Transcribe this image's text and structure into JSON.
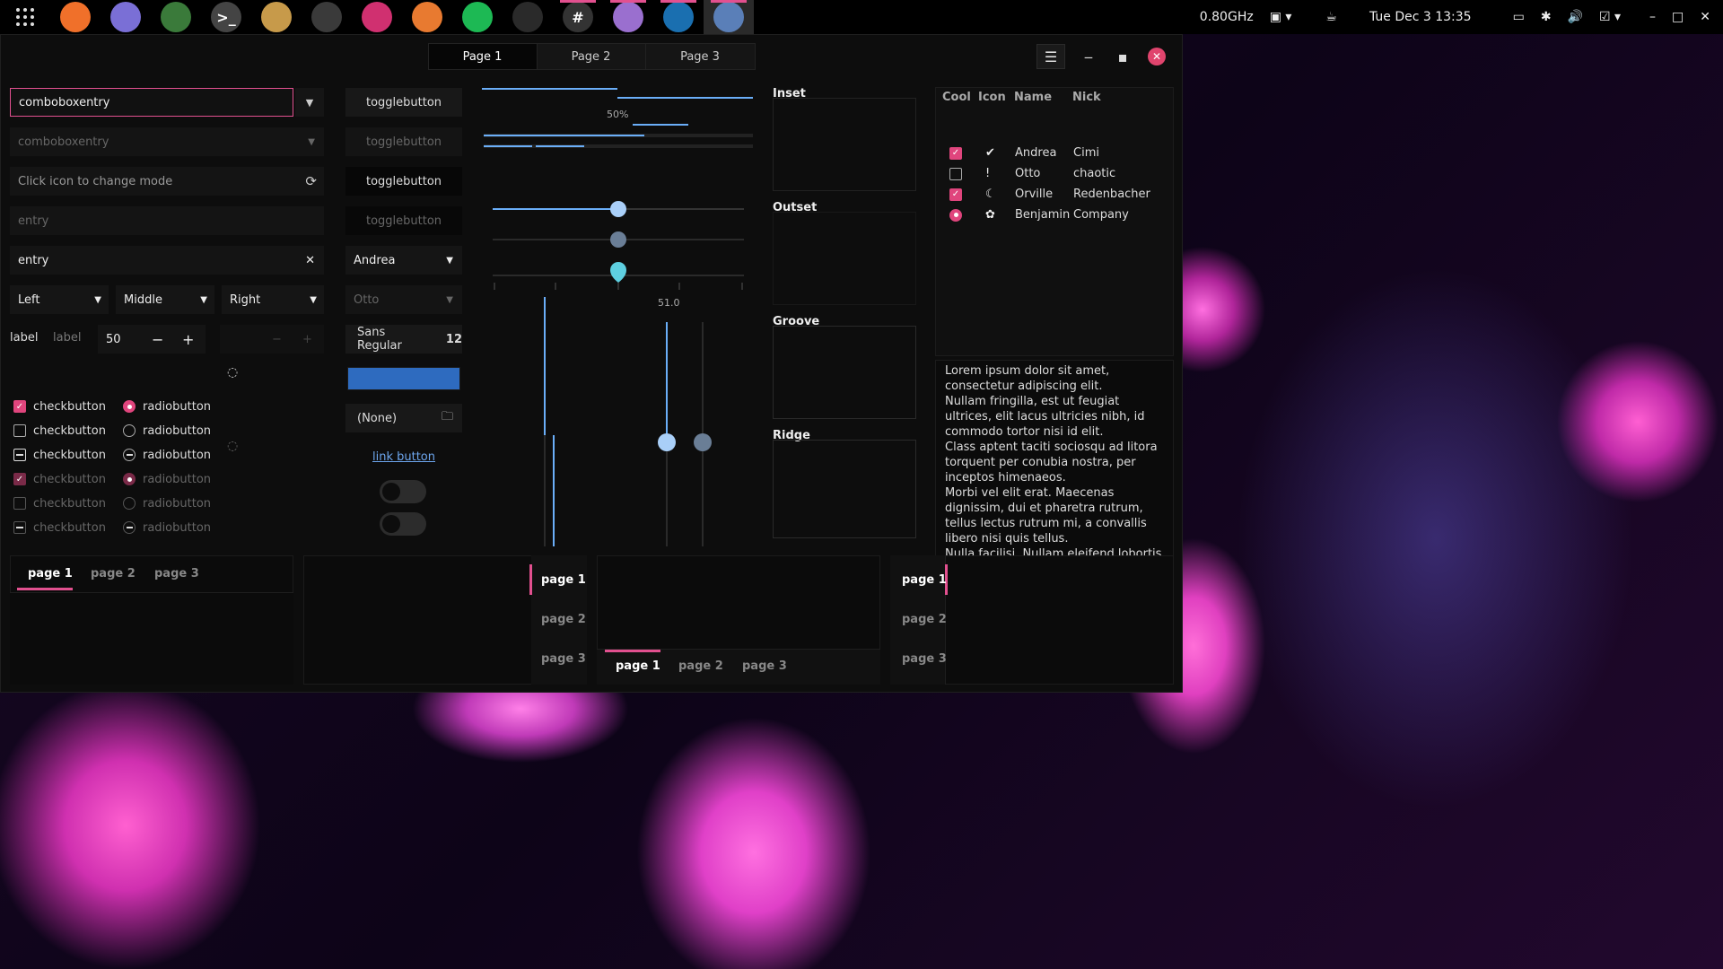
{
  "topbar": {
    "apps": [
      {
        "icon": "firefox-icon",
        "color": "#f0702a",
        "glyph": "",
        "active": false,
        "indicator": false
      },
      {
        "icon": "files-icon",
        "color": "#7a6fd6",
        "glyph": "",
        "active": false,
        "indicator": false
      },
      {
        "icon": "android-studio-icon",
        "color": "#3a7a3a",
        "glyph": "",
        "active": false,
        "indicator": false
      },
      {
        "icon": "terminal-icon",
        "color": "#444",
        "glyph": ">_",
        "active": false,
        "indicator": false
      },
      {
        "icon": "archive-manager-icon",
        "color": "#c79a4a",
        "glyph": "",
        "active": false,
        "indicator": false
      },
      {
        "icon": "darktable-icon",
        "color": "#3a3a3a",
        "glyph": "",
        "active": false,
        "indicator": false
      },
      {
        "icon": "color-picker-icon",
        "color": "#d03070",
        "glyph": "",
        "active": false,
        "indicator": false
      },
      {
        "icon": "hexchat-icon",
        "color": "#e87a30",
        "glyph": "",
        "active": false,
        "indicator": false
      },
      {
        "icon": "spotify-icon",
        "color": "#1db954",
        "glyph": "",
        "active": false,
        "indicator": false
      },
      {
        "icon": "steam-icon",
        "color": "#2a2a2a",
        "glyph": "",
        "active": false,
        "indicator": false
      },
      {
        "icon": "slack-icon",
        "color": "#333",
        "glyph": "#",
        "active": false,
        "indicator": true
      },
      {
        "icon": "text-editor-icon",
        "color": "#9a6fcf",
        "glyph": "",
        "active": false,
        "indicator": true
      },
      {
        "icon": "virtualbox-icon",
        "color": "#1a6fb0",
        "glyph": "",
        "active": false,
        "indicator": true
      },
      {
        "icon": "gtk-widget-factory-icon",
        "color": "#5a7fb8",
        "glyph": "",
        "active": true,
        "indicator": true
      }
    ],
    "cpu": "0.80GHz",
    "clock": "Tue Dec 3  13:35"
  },
  "header": {
    "tabs": [
      "Page 1",
      "Page 2",
      "Page 3"
    ]
  },
  "col1": {
    "combo1": "comboboxentry",
    "combo2": "comboboxentry",
    "mode_placeholder": "Click icon to change mode",
    "entry_dim": "entry",
    "entry": "entry",
    "align": [
      "Left",
      "Middle",
      "Right"
    ],
    "label1": "label",
    "label2": "label",
    "spin": "50",
    "checks": [
      "checkbutton",
      "checkbutton",
      "checkbutton",
      "checkbutton",
      "checkbutton",
      "checkbutton"
    ],
    "radios": [
      "radiobutton",
      "radiobutton",
      "radiobutton",
      "radiobutton",
      "radiobutton",
      "radiobutton"
    ]
  },
  "col2": {
    "toggles": [
      "togglebutton",
      "togglebutton",
      "togglebutton",
      "togglebutton"
    ],
    "combo_a": "Andrea",
    "combo_b": "Otto",
    "font": "Sans Regular",
    "font_size": "12",
    "file": "(None)",
    "link": "link button"
  },
  "sliders": {
    "progress_label": "50%",
    "scale_value": "51.0",
    "progress": 0.5,
    "scale": 0.51
  },
  "frames": [
    "Inset",
    "Outset",
    "Groove",
    "Ridge"
  ],
  "tree": {
    "headers": [
      "Cool",
      "Icon",
      "Name",
      "Nick"
    ],
    "rows": [
      {
        "cool": true,
        "icon": "check-circle-icon",
        "glyph": "✔",
        "name": "Andrea",
        "nick": "Cimi"
      },
      {
        "cool": false,
        "icon": "warning-icon",
        "glyph": "!",
        "name": "Otto",
        "nick": "chaotic"
      },
      {
        "cool": true,
        "icon": "moon-icon",
        "glyph": "☾",
        "name": "Orville",
        "nick": "Redenbacher"
      },
      {
        "cool": "radio",
        "icon": "bug-icon",
        "glyph": "✿",
        "name": "Benjamin",
        "nick": "Company"
      }
    ]
  },
  "textview": "Lorem ipsum dolor sit amet, consectetur adipiscing elit.\nNullam fringilla, est ut feugiat ultrices, elit lacus ultricies nibh, id commodo tortor nisi id elit.\nClass aptent taciti sociosqu ad litora torquent per conubia nostra, per inceptos himenaeos.\nMorbi vel elit erat. Maecenas dignissim, dui et pharetra rutrum, tellus lectus rutrum mi, a convallis libero nisi quis tellus.\nNulla facilisi. Nullam eleifend lobortis nisl, in porttitor tellus malesuada vitae.",
  "notebooks": {
    "tabs": [
      "page 1",
      "page 2",
      "page 3"
    ]
  }
}
